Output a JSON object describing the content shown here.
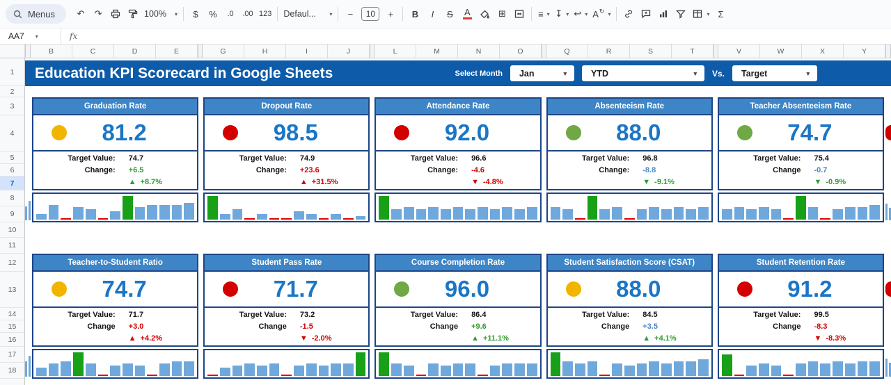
{
  "toolbar": {
    "menus_label": "Menus",
    "zoom_value": "100%",
    "font_name": "Defaul...",
    "font_size": "10"
  },
  "icons": {
    "undo": "↶",
    "redo": "↷",
    "caret_down": "▾",
    "dropdown_caret": "▼",
    "currency": "$",
    "percent": "%",
    "decimal_decrease": ".0",
    "decimal_increase": ".00",
    "number_format": "123",
    "minus": "−",
    "plus": "+",
    "bold": "B",
    "italic": "I",
    "strikethrough": "S",
    "text_color": "A",
    "borders": "⊞",
    "align_horizontal": "≡",
    "align_vertical": "↧",
    "text_wrap": "↩",
    "rotate_letter": "A",
    "rotate_arrow": "↻",
    "sigma": "Σ",
    "arrow_up": "▲",
    "arrow_down": "▼"
  },
  "formula_bar": {
    "cell_ref": "AA7",
    "fx_label": "fx"
  },
  "column_groups": [
    [
      "B",
      "C",
      "D",
      "E"
    ],
    [
      "G",
      "H",
      "I",
      "J"
    ],
    [
      "L",
      "M",
      "N",
      "O"
    ],
    [
      "Q",
      "R",
      "S",
      "T"
    ],
    [
      "V",
      "W",
      "X",
      "Y"
    ]
  ],
  "rows": [
    "1",
    "2",
    "3",
    "4",
    "5",
    "6",
    "7",
    "8",
    "9",
    "10",
    "11",
    "12",
    "13",
    "14",
    "15",
    "16",
    "17",
    "18"
  ],
  "selected_row": "7",
  "banner": {
    "title": "Education KPI Scorecard in Google Sheets",
    "select_month_label": "Select Month",
    "month_value": "Jan",
    "period_value": "YTD",
    "vs_label": "Vs.",
    "compare_value": "Target"
  },
  "colors": {
    "banner_bg": "#0d5ba9",
    "card_header_bg": "#3d85c6",
    "card_border": "#1c4587",
    "value_text": "#1b76c5",
    "bar_blue": "#6fa8dc",
    "bar_green": "#18a018",
    "bar_zero": "#e00000",
    "selected_row_bg": "#d3e3fd",
    "status_yellow": "#f1b500",
    "status_red": "#d40000",
    "status_green": "#6fa845"
  },
  "cards": [
    {
      "title": "Graduation Rate",
      "value": "81.2",
      "status_color": "#f1b500",
      "target_label": "Target Value:",
      "target": "74.7",
      "change_label": "Change:",
      "change": "+6.5",
      "change_color": "#2f9e2f",
      "trend": "up",
      "trend_color": "#2f9e2f",
      "trend_pct": "+8.7%",
      "bars": [
        2,
        6,
        0,
        5,
        4,
        0,
        3,
        10,
        5,
        6,
        6,
        6,
        7
      ],
      "green_index": 7
    },
    {
      "title": "Dropout Rate",
      "value": "98.5",
      "status_color": "#d40000",
      "target_label": "Target Value:",
      "target": "74.9",
      "change_label": "Change:",
      "change": "+23.6",
      "change_color": "#d40000",
      "trend": "up",
      "trend_color": "#d40000",
      "trend_pct": "+31.5%",
      "bars": [
        10,
        2,
        4,
        0,
        2,
        0,
        0,
        3,
        2,
        0,
        2,
        0,
        1
      ],
      "green_index": 0
    },
    {
      "title": "Attendance Rate",
      "value": "92.0",
      "status_color": "#d40000",
      "target_label": "Target Value:",
      "target": "96.6",
      "change_label": "Change:",
      "change": "-4.6",
      "change_color": "#d40000",
      "trend": "down",
      "trend_color": "#d40000",
      "trend_pct": "-4.8%",
      "bars": [
        10,
        4,
        5,
        4,
        5,
        4,
        5,
        4,
        5,
        4,
        5,
        4,
        5
      ],
      "green_index": 0
    },
    {
      "title": "Absenteeism Rate",
      "value": "88.0",
      "status_color": "#6fa845",
      "target_label": "Target Value:",
      "target": "96.8",
      "change_label": "Change:",
      "change": "-8.8",
      "change_color": "#4a86c8",
      "trend": "down",
      "trend_color": "#2f9e2f",
      "trend_pct": "-9.1%",
      "bars": [
        5,
        4,
        0,
        10,
        4,
        5,
        0,
        4,
        5,
        4,
        5,
        4,
        5
      ],
      "green_index": 3
    },
    {
      "title": "Teacher Absenteeism Rate",
      "value": "74.7",
      "status_color": "#6fa845",
      "target_label": "Target Value:",
      "target": "75.4",
      "change_label": "Change",
      "change": "-0.7",
      "change_color": "#4a86c8",
      "trend": "down",
      "trend_color": "#2f9e2f",
      "trend_pct": "-0.9%",
      "bars": [
        4,
        5,
        4,
        5,
        4,
        0,
        10,
        5,
        0,
        4,
        5,
        5,
        6
      ],
      "green_index": 6
    },
    {
      "title": "Teacher-to-Student Ratio",
      "value": "74.7",
      "status_color": "#f1b500",
      "target_label": "Target Value:",
      "target": "71.7",
      "change_label": "Change",
      "change": "+3.0",
      "change_color": "#d40000",
      "trend": "up",
      "trend_color": "#d40000",
      "trend_pct": "+4.2%",
      "bars": [
        3,
        5,
        6,
        10,
        5,
        0,
        4,
        5,
        4,
        0,
        5,
        6,
        6
      ],
      "green_index": 3
    },
    {
      "title": "Student Pass Rate",
      "value": "71.7",
      "status_color": "#d40000",
      "target_label": "Target Value:",
      "target": "73.2",
      "change_label": "Change",
      "change": "-1.5",
      "change_color": "#d40000",
      "trend": "down",
      "trend_color": "#d40000",
      "trend_pct": "-2.0%",
      "bars": [
        0,
        3,
        4,
        5,
        4,
        5,
        0,
        4,
        5,
        4,
        5,
        5,
        10
      ],
      "green_index": 12
    },
    {
      "title": "Course Completion Rate",
      "value": "96.0",
      "status_color": "#6fa845",
      "target_label": "Target Value:",
      "target": "86.4",
      "change_label": "Change",
      "change": "+9.6",
      "change_color": "#2f9e2f",
      "trend": "up",
      "trend_color": "#2f9e2f",
      "trend_pct": "+11.1%",
      "bars": [
        10,
        5,
        4,
        0,
        5,
        4,
        5,
        5,
        0,
        4,
        5,
        5,
        5
      ],
      "green_index": 0
    },
    {
      "title": "Student Satisfaction Score (CSAT)",
      "value": "88.0",
      "status_color": "#f1b500",
      "target_label": "Target Value:",
      "target": "84.5",
      "change_label": "Change",
      "change": "+3.5",
      "change_color": "#4a86c8",
      "trend": "up",
      "trend_color": "#2f9e2f",
      "trend_pct": "+4.1%",
      "bars": [
        10,
        6,
        5,
        6,
        0,
        5,
        4,
        5,
        6,
        5,
        6,
        6,
        7
      ],
      "green_index": 0
    },
    {
      "title": "Student Retention Rate",
      "value": "91.2",
      "status_color": "#d40000",
      "target_label": "Target Value:",
      "target": "99.5",
      "change_label": "Change",
      "change": "-8.3",
      "change_color": "#d40000",
      "trend": "down",
      "trend_color": "#d40000",
      "trend_pct": "-8.3%",
      "bars": [
        9,
        0,
        4,
        5,
        4,
        0,
        5,
        6,
        5,
        6,
        5,
        6,
        6
      ],
      "green_index": 0
    }
  ]
}
